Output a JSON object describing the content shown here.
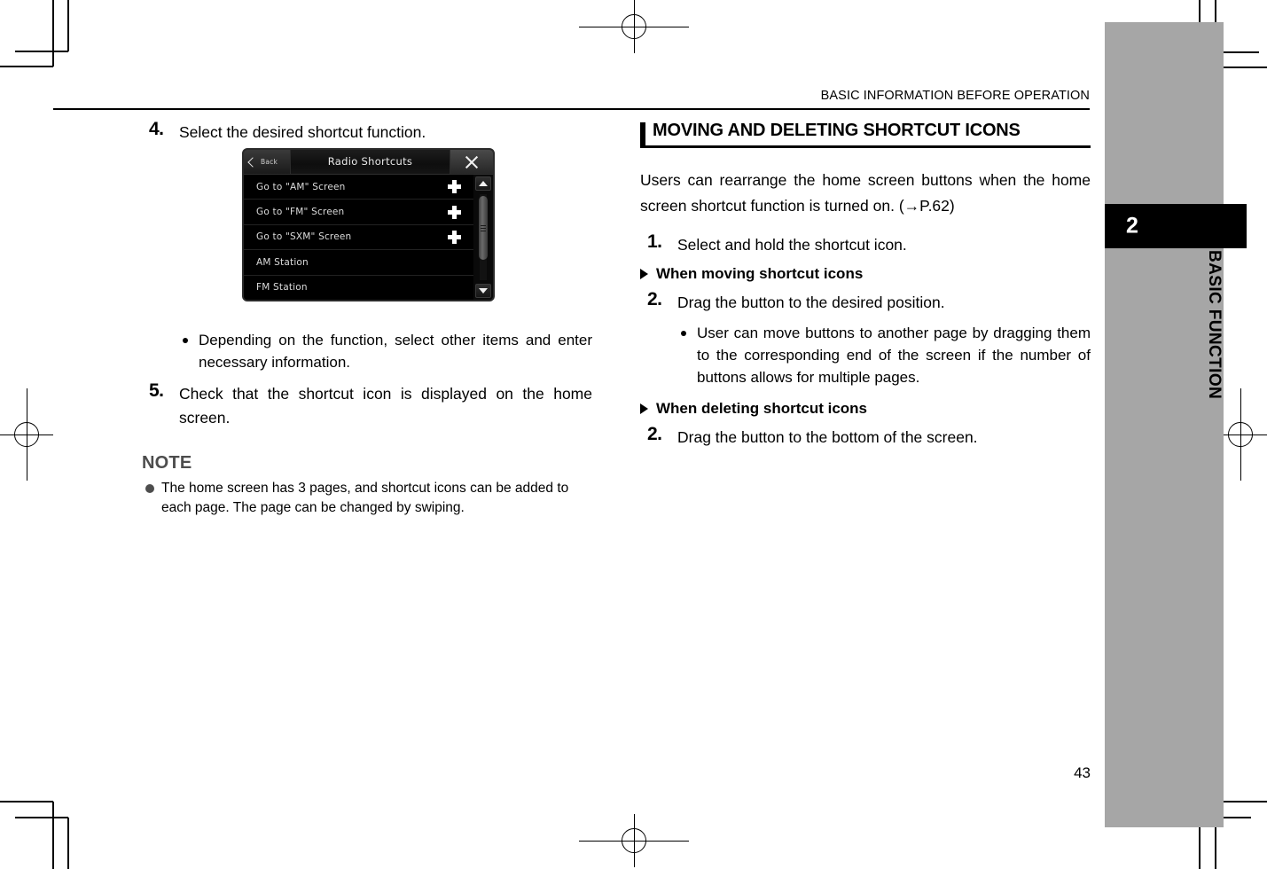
{
  "document": {
    "running_header": "BASIC INFORMATION BEFORE OPERATION",
    "page_number": "43",
    "chapter_number": "2",
    "chapter_name": "BASIC FUNCTION"
  },
  "left_column": {
    "step4": {
      "num": "4.",
      "text": "Select the desired shortcut function."
    },
    "bullet1": "Depending on the function, select other items and enter necessary information.",
    "step5": {
      "num": "5.",
      "text": "Check that the shortcut icon is displayed on the home screen."
    },
    "note": {
      "heading": "NOTE",
      "item1": "The home screen has 3 pages, and shortcut icons can be added to each page. The page can be changed by swiping."
    }
  },
  "device_screen": {
    "back_label": "Back",
    "title": "Radio Shortcuts",
    "close_icon": "close-x-icon",
    "back_icon": "chevron-left-icon",
    "rows": [
      {
        "label": "Go to \"AM\" Screen",
        "action": "plus-icon"
      },
      {
        "label": "Go to \"FM\" Screen",
        "action": "plus-icon"
      },
      {
        "label": "Go to \"SXM\" Screen",
        "action": "plus-icon"
      },
      {
        "label": "AM Station",
        "action": ""
      },
      {
        "label": "FM Station",
        "action": ""
      }
    ],
    "scroll": {
      "up_icon": "scroll-up-arrow-icon",
      "down_icon": "scroll-down-arrow-icon"
    }
  },
  "right_column": {
    "section_title": "MOVING AND DELETING SHORTCUT ICONS",
    "intro": "Users can rearrange the home screen buttons when the home screen shortcut function is turned on. (→P.62)",
    "step1": {
      "num": "1.",
      "text": "Select and hold the shortcut icon."
    },
    "subhead_moving": "When moving shortcut icons",
    "step2_moving": {
      "num": "2.",
      "text": "Drag the button to the desired position."
    },
    "bullet_moving": "User can move buttons to another page by dragging them to the corresponding end of the screen if the number of buttons allows for multiple pages.",
    "subhead_deleting": "When deleting shortcut icons",
    "step2_deleting": {
      "num": "2.",
      "text": "Drag the button to the bottom of the screen."
    }
  },
  "colors": {
    "sidebar_gray": "#a6a6a6",
    "chapter_tab": "#000000",
    "note_gray": "#4d4d4d",
    "device_black": "#000000"
  }
}
